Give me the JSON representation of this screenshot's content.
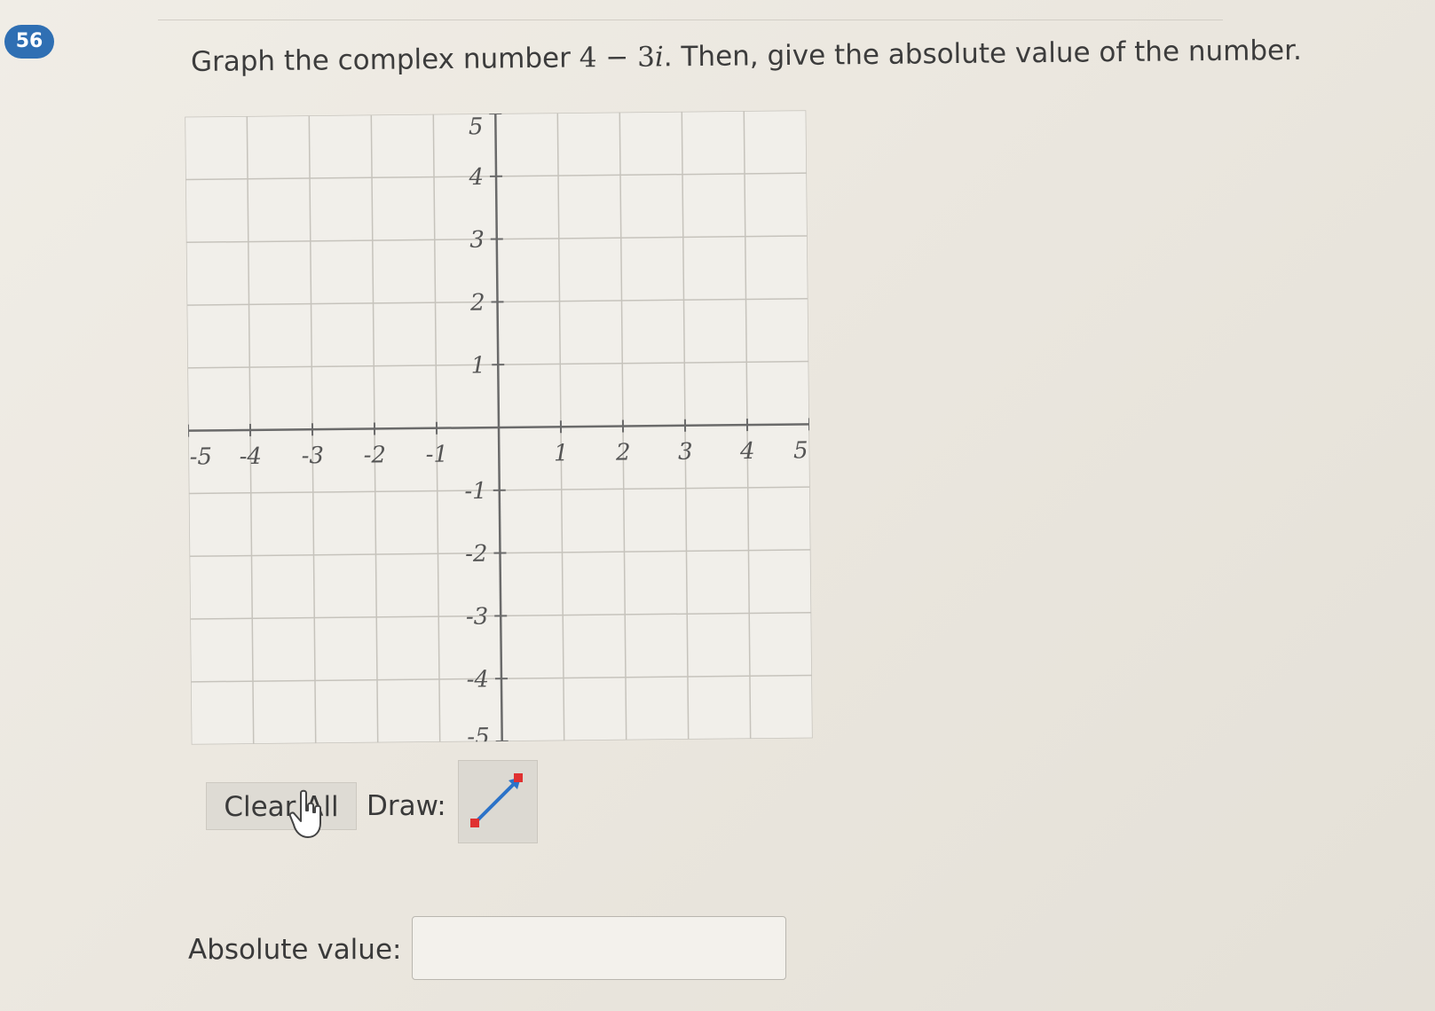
{
  "question": {
    "number": "56",
    "prompt_before": "Graph the complex number ",
    "math_real": "4",
    "math_op": " − ",
    "math_coef": "3",
    "math_unit": "i",
    "prompt_after": ". Then, give the absolute value of the number."
  },
  "graph": {
    "x_ticks": [
      "-5",
      "-4",
      "-3",
      "-2",
      "-1",
      "1",
      "2",
      "3",
      "4",
      "5"
    ],
    "y_ticks": [
      "5",
      "4",
      "3",
      "2",
      "1",
      "-1",
      "-2",
      "-3",
      "-4",
      "-5"
    ],
    "x_range": [
      -5,
      5
    ],
    "y_range": [
      -5,
      5
    ],
    "grid": true,
    "colors": {
      "grid": "#c6c3bc",
      "axis": "#6a6a6a",
      "background": "#f1efea"
    }
  },
  "controls": {
    "clear_label": "Clear All",
    "draw_label": "Draw:",
    "draw_tool_icon": "vector-arrow-icon",
    "tool_color": "#e03131",
    "tool_line_color": "#2c73c8"
  },
  "answer": {
    "label": "Absolute value:",
    "value": ""
  }
}
